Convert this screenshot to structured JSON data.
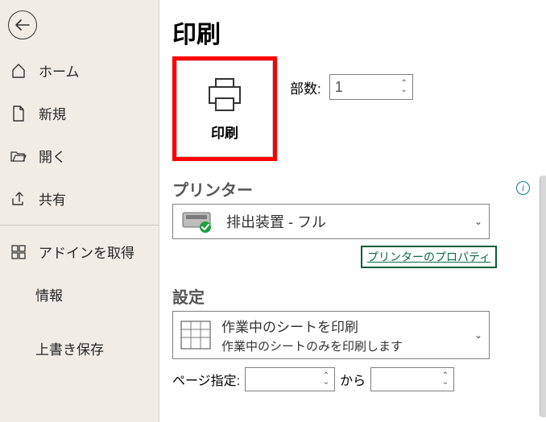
{
  "sidebar": {
    "items": [
      {
        "label": "ホーム"
      },
      {
        "label": "新規"
      },
      {
        "label": "開く"
      },
      {
        "label": "共有"
      },
      {
        "label": "アドインを取得"
      }
    ],
    "sub": [
      {
        "label": "情報"
      },
      {
        "label": "上書き保存"
      }
    ]
  },
  "page": {
    "title": "印刷",
    "print_button_label": "印刷",
    "copies_label": "部数:",
    "copies_value": "1"
  },
  "printer": {
    "section_title": "プリンター",
    "name": "排出装置 - フル",
    "properties_link": "プリンターのプロパティ"
  },
  "settings": {
    "section_title": "設定",
    "scope_line1": "作業中のシートを印刷",
    "scope_line2": "作業中のシートのみを印刷します",
    "pages_label": "ページ指定:",
    "pages_from": "",
    "pages_to_label": "から",
    "pages_to": ""
  }
}
